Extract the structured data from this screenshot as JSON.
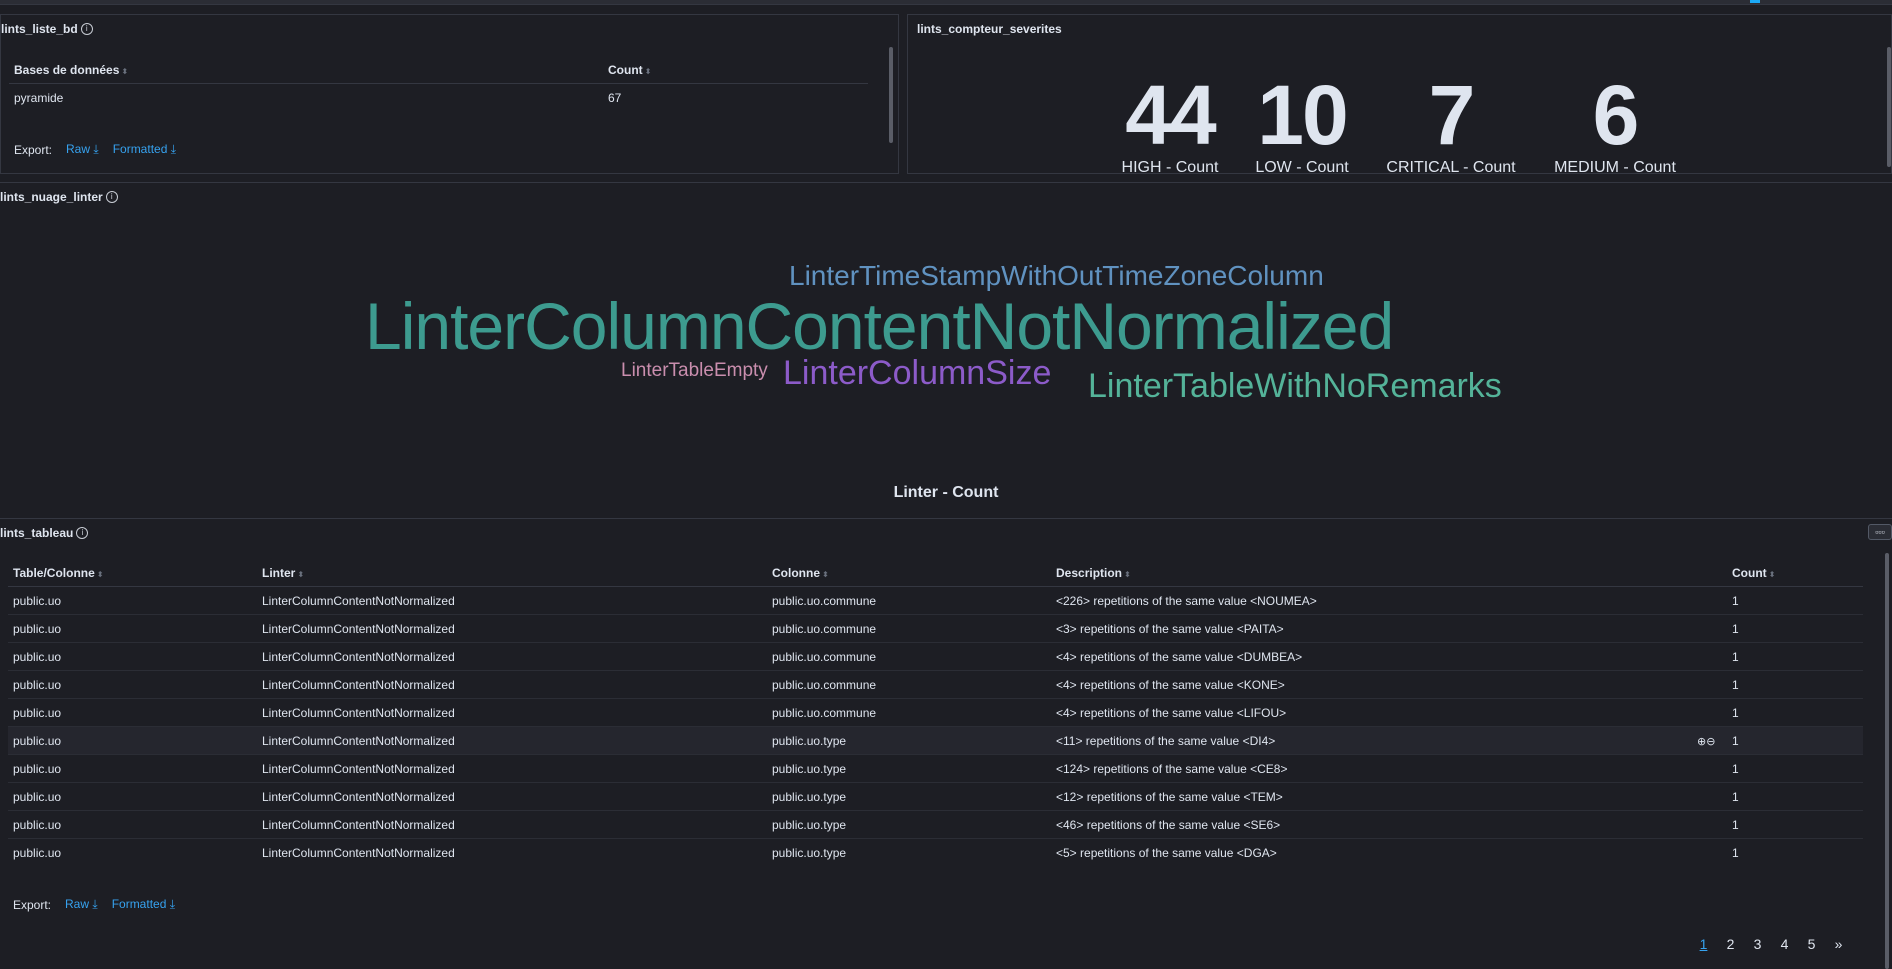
{
  "colors": {
    "accent": "#36a2ef",
    "background": "#1d1e24",
    "border": "#343741"
  },
  "panel_liste_bd": {
    "title": "lints_liste_bd",
    "columns": [
      "Bases de données",
      "Count"
    ],
    "rows": [
      [
        "pyramide",
        "67"
      ]
    ],
    "export": {
      "label": "Export:",
      "raw": "Raw",
      "formatted": "Formatted"
    }
  },
  "panel_compteur": {
    "title": "lints_compteur_severites",
    "metrics": [
      {
        "value": "44",
        "label": "HIGH - Count"
      },
      {
        "value": "10",
        "label": "LOW - Count"
      },
      {
        "value": "7",
        "label": "CRITICAL - Count"
      },
      {
        "value": "6",
        "label": "MEDIUM - Count"
      }
    ]
  },
  "panel_nuage": {
    "title": "lints_nuage_linter",
    "words": [
      {
        "text": "LinterTimeStampWithOutTimeZoneColumn",
        "color": "#6092c0"
      },
      {
        "text": "LinterColumnContentNotNormalized",
        "color": "#3d9b8f"
      },
      {
        "text": "LinterTableEmpty",
        "color": "#ca8eae"
      },
      {
        "text": "LinterColumnSize",
        "color": "#8c5bc9"
      },
      {
        "text": "LinterTableWithNoRemarks",
        "color": "#54b399"
      }
    ],
    "caption": "Linter - Count"
  },
  "panel_tableau": {
    "title": "lints_tableau",
    "columns": [
      "Table/Colonne",
      "Linter",
      "Colonne",
      "Description",
      "Count"
    ],
    "rows": [
      [
        "public.uo",
        "LinterColumnContentNotNormalized",
        "public.uo.commune",
        "<226> repetitions of the same value <NOUMEA>",
        "1"
      ],
      [
        "public.uo",
        "LinterColumnContentNotNormalized",
        "public.uo.commune",
        "<3> repetitions of the same value <PAITA>",
        "1"
      ],
      [
        "public.uo",
        "LinterColumnContentNotNormalized",
        "public.uo.commune",
        "<4> repetitions of the same value <DUMBEA>",
        "1"
      ],
      [
        "public.uo",
        "LinterColumnContentNotNormalized",
        "public.uo.commune",
        "<4> repetitions of the same value <KONE>",
        "1"
      ],
      [
        "public.uo",
        "LinterColumnContentNotNormalized",
        "public.uo.commune",
        "<4> repetitions of the same value <LIFOU>",
        "1"
      ],
      [
        "public.uo",
        "LinterColumnContentNotNormalized",
        "public.uo.type",
        "<11> repetitions of the same value <DI4>",
        "1"
      ],
      [
        "public.uo",
        "LinterColumnContentNotNormalized",
        "public.uo.type",
        "<124> repetitions of the same value <CE8>",
        "1"
      ],
      [
        "public.uo",
        "LinterColumnContentNotNormalized",
        "public.uo.type",
        "<12> repetitions of the same value <TEM>",
        "1"
      ],
      [
        "public.uo",
        "LinterColumnContentNotNormalized",
        "public.uo.type",
        "<46> repetitions of the same value <SE6>",
        "1"
      ],
      [
        "public.uo",
        "LinterColumnContentNotNormalized",
        "public.uo.type",
        "<5> repetitions of the same value <DGA>",
        "1"
      ]
    ],
    "export": {
      "label": "Export:",
      "raw": "Raw",
      "formatted": "Formatted"
    },
    "pagination": {
      "pages": [
        "1",
        "2",
        "3",
        "4",
        "5"
      ],
      "next": "»",
      "current": "1"
    }
  }
}
